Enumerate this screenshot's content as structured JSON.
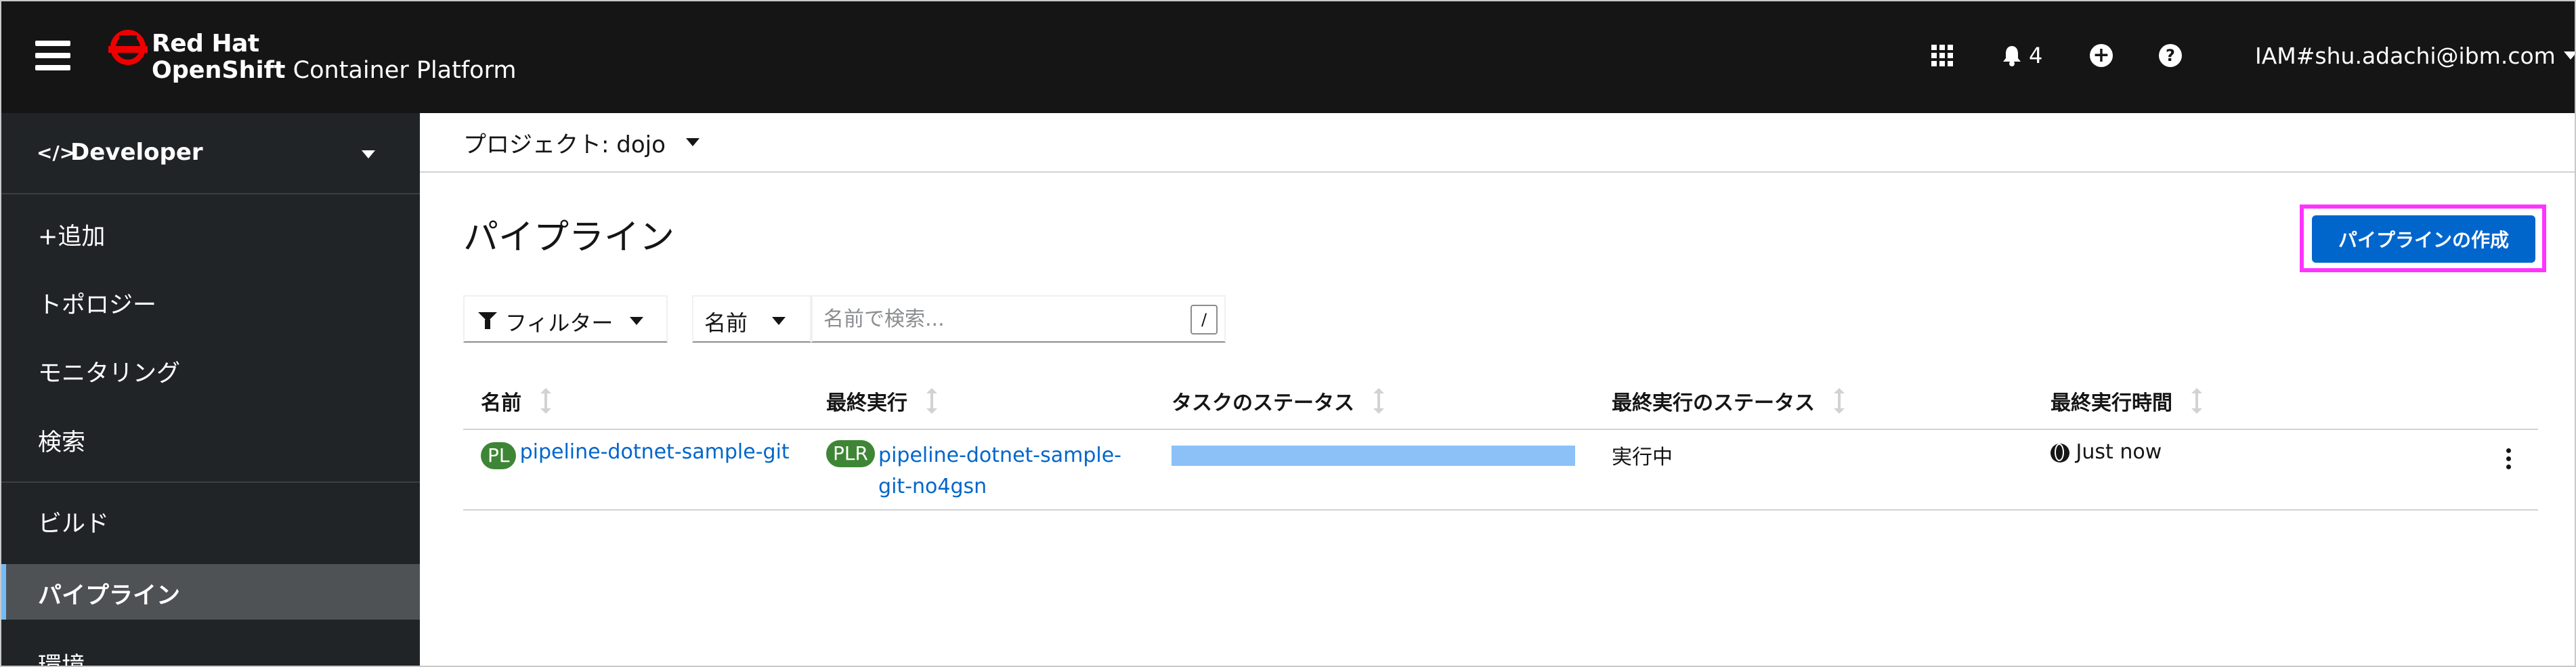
{
  "masthead": {
    "brand_line1": "Red Hat",
    "brand_line2_bold": "OpenShift",
    "brand_line2_rest": " Container Platform",
    "notifications_count": "4",
    "plus_glyph": "+",
    "help_glyph": "?",
    "user": "IAM#shu.adachi@ibm.com",
    "icons": [
      "hamburger-icon",
      "app-launcher-icon",
      "bell-icon",
      "plus-circle-icon",
      "question-circle-icon"
    ]
  },
  "sidebar": {
    "perspective_code": "</>",
    "perspective": "Developer",
    "items": [
      {
        "label": "+追加"
      },
      {
        "label": "トポロジー"
      },
      {
        "label": "モニタリング"
      },
      {
        "label": "検索"
      },
      {
        "label": "ビルド"
      },
      {
        "label": "パイプライン",
        "active": true
      },
      {
        "label": "環境"
      }
    ]
  },
  "project_bar": {
    "label": "プロジェクト: dojo"
  },
  "page": {
    "title": "パイプライン",
    "create_button": "パイプラインの作成"
  },
  "toolbar": {
    "filter_label": "フィルター",
    "attribute_label": "名前",
    "search_placeholder": "名前で検索...",
    "shortcut": "/"
  },
  "table": {
    "headers": [
      "名前",
      "最終実行",
      "タスクのステータス",
      "最終実行のステータス",
      "最終実行時間"
    ],
    "rows": [
      {
        "name_badge": "PL",
        "name": "pipeline-dotnet-sample-git",
        "last_run_badge": "PLR",
        "last_run_line1": "pipeline-dotnet-sample-",
        "last_run_line2": "git-no4gsn",
        "task_status_progress": 1.0,
        "last_run_status": "実行中",
        "last_run_time": "Just now"
      }
    ]
  },
  "colors": {
    "masthead_bg": "#151515",
    "sidebar_bg": "#212427",
    "accent_blue": "#0066cc",
    "task_bar": "#8bc1f7",
    "badge_green": "#3e8635",
    "highlight": "#ff33ff"
  }
}
